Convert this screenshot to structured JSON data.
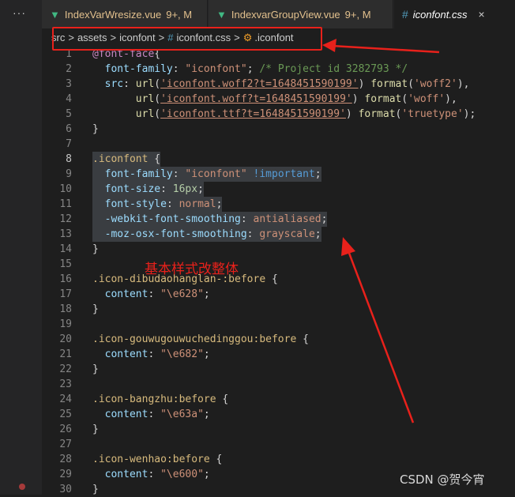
{
  "activity": {
    "more_icon": "···"
  },
  "tabs": [
    {
      "icon": "vue-icon",
      "name": "IndexVarWresize.vue",
      "badge": "9+, M"
    },
    {
      "icon": "vue-icon",
      "name": "IndexvarGroupView.vue",
      "badge": "9+, M"
    },
    {
      "icon": "css-hash-icon",
      "name": "iconfont.css",
      "close": "×"
    }
  ],
  "breadcrumb": {
    "items": [
      "src",
      "assets",
      "iconfont",
      "iconfont.css",
      ".iconfont"
    ],
    "separator": ">"
  },
  "annotation": "基本样式改整体",
  "watermark": "CSDN @贺今宵",
  "colors": {
    "accent_red": "#e8211b",
    "selection": "#3a3d41"
  },
  "code": {
    "lines": [
      {
        "n": "1",
        "segs": [
          [
            "c-at",
            "@font-face"
          ],
          [
            "",
            "{"
          ]
        ]
      },
      {
        "n": "2",
        "segs": [
          [
            "",
            "  "
          ],
          [
            "c-prop",
            "font-family"
          ],
          [
            "",
            ": "
          ],
          [
            "c-str",
            "\"iconfont\""
          ],
          [
            "",
            "; "
          ],
          [
            "c-com",
            "/* Project id 3282793 */"
          ]
        ]
      },
      {
        "n": "3",
        "segs": [
          [
            "",
            "  "
          ],
          [
            "c-prop",
            "src"
          ],
          [
            "",
            ": "
          ],
          [
            "c-fn",
            "url"
          ],
          [
            "",
            "("
          ],
          [
            "c-url",
            "'iconfont.woff2?t=1648451590199'"
          ],
          [
            "",
            ") "
          ],
          [
            "c-fn",
            "format"
          ],
          [
            "",
            "("
          ],
          [
            "c-str",
            "'woff2'"
          ],
          [
            "",
            "),"
          ]
        ]
      },
      {
        "n": "4",
        "segs": [
          [
            "",
            "       "
          ],
          [
            "c-fn",
            "url"
          ],
          [
            "",
            "("
          ],
          [
            "c-url",
            "'iconfont.woff?t=1648451590199'"
          ],
          [
            "",
            ") "
          ],
          [
            "c-fn",
            "format"
          ],
          [
            "",
            "("
          ],
          [
            "c-str",
            "'woff'"
          ],
          [
            "",
            "),"
          ]
        ]
      },
      {
        "n": "5",
        "segs": [
          [
            "",
            "       "
          ],
          [
            "c-fn",
            "url"
          ],
          [
            "",
            "("
          ],
          [
            "c-url",
            "'iconfont.ttf?t=1648451590199'"
          ],
          [
            "",
            ") "
          ],
          [
            "c-fn",
            "format"
          ],
          [
            "",
            "("
          ],
          [
            "c-str",
            "'truetype'"
          ],
          [
            "",
            ");"
          ]
        ]
      },
      {
        "n": "6",
        "segs": [
          [
            "",
            "}"
          ]
        ]
      },
      {
        "n": "7",
        "segs": []
      },
      {
        "n": "8",
        "active": true,
        "segs": [
          [
            "c-sel",
            ".iconfont"
          ],
          [
            "",
            " {"
          ]
        ]
      },
      {
        "n": "9",
        "segs": [
          [
            "",
            "  "
          ],
          [
            "c-prop",
            "font-family"
          ],
          [
            "",
            ": "
          ],
          [
            "c-str",
            "\"iconfont\""
          ],
          [
            "c-kw",
            " !important"
          ],
          [
            "",
            ";"
          ]
        ]
      },
      {
        "n": "10",
        "segs": [
          [
            "",
            "  "
          ],
          [
            "c-prop",
            "font-size"
          ],
          [
            "",
            ": "
          ],
          [
            "c-num",
            "16px"
          ],
          [
            "",
            ";"
          ]
        ]
      },
      {
        "n": "11",
        "segs": [
          [
            "",
            "  "
          ],
          [
            "c-prop",
            "font-style"
          ],
          [
            "",
            ": "
          ],
          [
            "c-str",
            "normal"
          ],
          [
            "",
            ";"
          ]
        ]
      },
      {
        "n": "12",
        "segs": [
          [
            "",
            "  "
          ],
          [
            "c-prop",
            "-webkit-font-smoothing"
          ],
          [
            "",
            ": "
          ],
          [
            "c-str",
            "antialiased"
          ],
          [
            "",
            ";"
          ]
        ]
      },
      {
        "n": "13",
        "segs": [
          [
            "",
            "  "
          ],
          [
            "c-prop",
            "-moz-osx-font-smoothing"
          ],
          [
            "",
            ": "
          ],
          [
            "c-str",
            "grayscale"
          ],
          [
            "",
            ";"
          ]
        ]
      },
      {
        "n": "14",
        "segs": [
          [
            "",
            "}"
          ]
        ]
      },
      {
        "n": "15",
        "segs": []
      },
      {
        "n": "16",
        "segs": [
          [
            "c-sel",
            ".icon-dibudaohanglan-:before"
          ],
          [
            "",
            " {"
          ]
        ]
      },
      {
        "n": "17",
        "segs": [
          [
            "",
            "  "
          ],
          [
            "c-prop",
            "content"
          ],
          [
            "",
            ": "
          ],
          [
            "c-str",
            "\"\\e628\""
          ],
          [
            "",
            ";"
          ]
        ]
      },
      {
        "n": "18",
        "segs": [
          [
            "",
            "}"
          ]
        ]
      },
      {
        "n": "19",
        "segs": []
      },
      {
        "n": "20",
        "segs": [
          [
            "c-sel",
            ".icon-gouwugouwuchedinggou:before"
          ],
          [
            "",
            " {"
          ]
        ]
      },
      {
        "n": "21",
        "segs": [
          [
            "",
            "  "
          ],
          [
            "c-prop",
            "content"
          ],
          [
            "",
            ": "
          ],
          [
            "c-str",
            "\"\\e682\""
          ],
          [
            "",
            ";"
          ]
        ]
      },
      {
        "n": "22",
        "segs": [
          [
            "",
            "}"
          ]
        ]
      },
      {
        "n": "23",
        "segs": []
      },
      {
        "n": "24",
        "segs": [
          [
            "c-sel",
            ".icon-bangzhu:before"
          ],
          [
            "",
            " {"
          ]
        ]
      },
      {
        "n": "25",
        "segs": [
          [
            "",
            "  "
          ],
          [
            "c-prop",
            "content"
          ],
          [
            "",
            ": "
          ],
          [
            "c-str",
            "\"\\e63a\""
          ],
          [
            "",
            ";"
          ]
        ]
      },
      {
        "n": "26",
        "segs": [
          [
            "",
            "}"
          ]
        ]
      },
      {
        "n": "27",
        "segs": []
      },
      {
        "n": "28",
        "segs": [
          [
            "c-sel",
            ".icon-wenhao:before"
          ],
          [
            "",
            " {"
          ]
        ]
      },
      {
        "n": "29",
        "segs": [
          [
            "",
            "  "
          ],
          [
            "c-prop",
            "content"
          ],
          [
            "",
            ": "
          ],
          [
            "c-str",
            "\"\\e600\""
          ],
          [
            "",
            ";"
          ]
        ]
      },
      {
        "n": "30",
        "segs": [
          [
            "",
            "}"
          ]
        ]
      }
    ]
  }
}
